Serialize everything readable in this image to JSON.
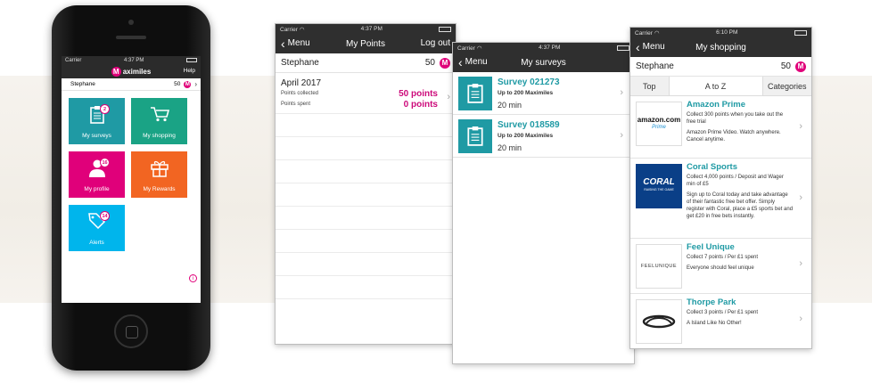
{
  "phone": {
    "status": {
      "carrier": "Carrier",
      "time": "4:37 PM"
    },
    "brand": "aximiles",
    "logo_letter": "M",
    "help": "Help",
    "user": {
      "name": "Stephane",
      "points": "50"
    },
    "tiles": [
      {
        "label": "My surveys",
        "badge": "2",
        "color": "#1f9aa4"
      },
      {
        "label": "My shopping",
        "badge": "",
        "color": "#1aa385"
      },
      {
        "label": "My profile",
        "badge": "16",
        "color": "#e0007a"
      },
      {
        "label": "My Rewards",
        "badge": "",
        "color": "#f26522"
      },
      {
        "label": "Alerts",
        "badge": "14",
        "color": "#00b5ec"
      }
    ],
    "info": "i"
  },
  "points_screen": {
    "status": {
      "carrier": "Carrier",
      "time": "4:37 PM"
    },
    "back": "Menu",
    "title": "My Points",
    "right": "Log out",
    "user": {
      "name": "Stephane",
      "points": "50"
    },
    "month": "April 2017",
    "rows": [
      {
        "label": "Points collected",
        "value": "50 points"
      },
      {
        "label": "Points spent",
        "value": "0 points"
      }
    ]
  },
  "surveys_screen": {
    "status": {
      "carrier": "Carrier",
      "time": "4:37 PM"
    },
    "back": "Menu",
    "title": "My surveys",
    "items": [
      {
        "title": "Survey 021273",
        "reward": "Up to 200 Maximiles",
        "duration": "20 min"
      },
      {
        "title": "Survey 018589",
        "reward": "Up to 200 Maximiles",
        "duration": "20 min"
      }
    ]
  },
  "shopping_screen": {
    "status": {
      "carrier": "Carrier",
      "time": "6:10 PM"
    },
    "back": "Menu",
    "title": "My shopping",
    "user": {
      "name": "Stephane",
      "points": "50"
    },
    "tabs": [
      "Top",
      "A to Z",
      "Categories"
    ],
    "items": [
      {
        "name": "Amazon Prime",
        "desc1": "Collect 300 points when you take out the free trial",
        "desc2": "Amazon Prime Video. Watch anywhere. Cancel anytime.",
        "logo_text": "amazon.com",
        "logo_sub": "Prime"
      },
      {
        "name": "Coral Sports",
        "desc1": "Collect 4,000 points / Deposit and Wager min of £5",
        "desc2": "Sign up to Coral today and take advantage of their fantastic free bet offer. Simply register with Coral, place a £5 sports bet and get £20 in free bets instantly.",
        "logo_text": "CORAL",
        "logo_sub": "RAISING THE GAME"
      },
      {
        "name": "Feel Unique",
        "desc1": "Collect 7 points / Per £1 spent",
        "desc2": "Everyone should feel unique",
        "logo_text": "FEELUNIQUE",
        "logo_sub": ""
      },
      {
        "name": "Thorpe Park",
        "desc1": "Collect 3 points / Per £1 spent",
        "desc2": "A Island Like No Other!",
        "logo_text": "",
        "logo_sub": ""
      }
    ]
  }
}
